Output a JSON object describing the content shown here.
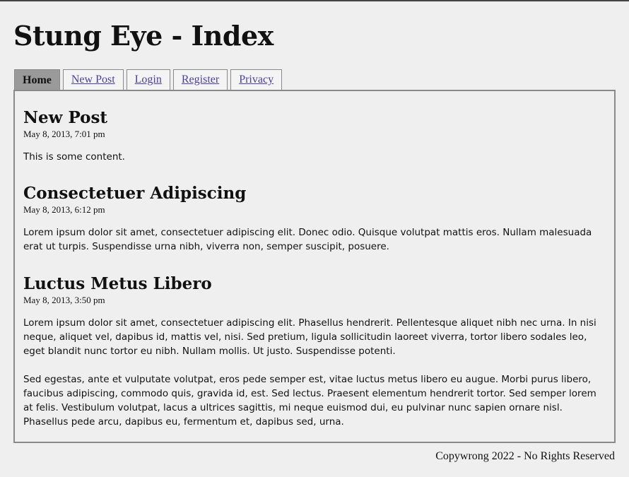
{
  "site": {
    "title": "Stung Eye - Index"
  },
  "nav": {
    "tabs": [
      {
        "label": "Home"
      },
      {
        "label": "New Post"
      },
      {
        "label": "Login"
      },
      {
        "label": "Register"
      },
      {
        "label": "Privacy"
      }
    ]
  },
  "posts": [
    {
      "title": "New Post",
      "date": "May 8, 2013, 7:01 pm",
      "paragraphs": [
        "This is some content."
      ]
    },
    {
      "title": "Consectetuer Adipiscing",
      "date": "May 8, 2013, 6:12 pm",
      "paragraphs": [
        "Lorem ipsum dolor sit amet, consectetuer adipiscing elit. Donec odio. Quisque volutpat mattis eros. Nullam malesuada erat ut turpis. Suspendisse urna nibh, viverra non, semper suscipit, posuere."
      ]
    },
    {
      "title": "Luctus Metus Libero",
      "date": "May 8, 2013, 3:50 pm",
      "paragraphs": [
        "Lorem ipsum dolor sit amet, consectetuer adipiscing elit. Phasellus hendrerit. Pellentesque aliquet nibh nec urna. In nisi neque, aliquet vel, dapibus id, mattis vel, nisi. Sed pretium, ligula sollicitudin laoreet viverra, tortor libero sodales leo, eget blandit nunc tortor eu nibh. Nullam mollis. Ut justo. Suspendisse potenti.",
        "Sed egestas, ante et vulputate volutpat, eros pede semper est, vitae luctus metus libero eu augue. Morbi purus libero, faucibus adipiscing, commodo quis, gravida id, est. Sed lectus. Praesent elementum hendrerit tortor. Sed semper lorem at felis. Vestibulum volutpat, lacus a ultrices sagittis, mi neque euismod dui, eu pulvinar nunc sapien ornare nisl. Phasellus pede arcu, dapibus eu, fermentum et, dapibus sed, urna."
      ]
    }
  ],
  "footer": {
    "text": "Copywrong 2022 - No Rights Reserved"
  }
}
